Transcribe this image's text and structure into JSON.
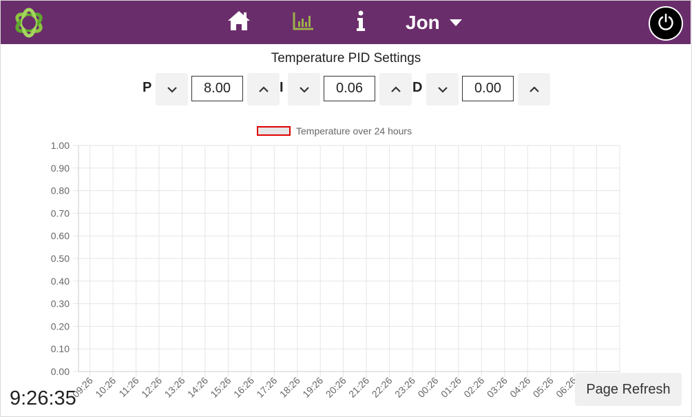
{
  "header": {
    "user_name": "Jon",
    "brand_color": "#6a2d6b",
    "icons": [
      "logo-icon",
      "home-icon",
      "chart-icon",
      "info-icon",
      "caret-down-icon",
      "power-icon"
    ]
  },
  "page_title": "Temperature PID Settings",
  "pid": {
    "p": {
      "label": "P",
      "value": "8.00"
    },
    "i": {
      "label": "I",
      "value": "0.06"
    },
    "d": {
      "label": "D",
      "value": "0.00"
    }
  },
  "chart_data": {
    "type": "line",
    "series": [
      {
        "name": "Temperature over 24 hours",
        "values": []
      }
    ],
    "x": [
      "09:26",
      "10:26",
      "11:26",
      "12:26",
      "13:26",
      "14:26",
      "15:26",
      "16:26",
      "17:26",
      "18:26",
      "19:26",
      "20:26",
      "21:26",
      "22:26",
      "23:26",
      "00:26",
      "01:26",
      "02:26",
      "03:26",
      "04:26",
      "05:26",
      "06:26",
      "07:26",
      "08:26"
    ],
    "y_ticks": [
      "1.00",
      "0.90",
      "0.80",
      "0.70",
      "0.60",
      "0.50",
      "0.40",
      "0.30",
      "0.20",
      "0.10",
      "0.00"
    ],
    "ylim": [
      0,
      1
    ],
    "grid": true,
    "legend": "top",
    "colors": {
      "border": "#e00000",
      "fill": "#e6e6e6",
      "grid": "#e5e5e5",
      "tick": "#666666"
    }
  },
  "clock": "9:26:35",
  "refresh_label": "Page Refresh"
}
